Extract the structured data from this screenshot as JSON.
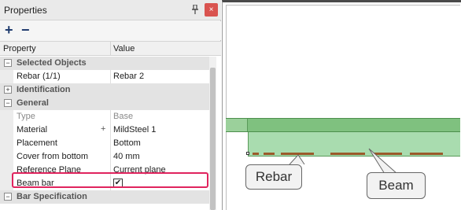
{
  "panel": {
    "title": "Properties",
    "pin_glyph": "📌",
    "close_glyph": "×",
    "toolbar": {
      "expand_glyph": "+",
      "collapse_glyph": "−"
    }
  },
  "grid": {
    "headers": {
      "property": "Property",
      "value": "Value"
    },
    "rows": [
      {
        "label": "Selected Objects",
        "category": true,
        "expander": "−"
      },
      {
        "label": "Rebar (1/1)",
        "value": "Rebar 2"
      },
      {
        "label": "Identification",
        "category": true,
        "expander": "+"
      },
      {
        "label": "General",
        "category": true,
        "expander": "−"
      },
      {
        "label": "Type",
        "value": "Base",
        "muted": true
      },
      {
        "label": "Material",
        "value": "MildSteel 1",
        "plus": "+"
      },
      {
        "label": "Placement",
        "value": "Bottom"
      },
      {
        "label": "Cover from bottom",
        "value": "40 mm"
      },
      {
        "label": "Reference Plane",
        "value": "Current plane"
      },
      {
        "label": "Beam bar",
        "value": "✔",
        "checkbox": true,
        "checked": true
      },
      {
        "label": "Bar Specification",
        "category": true,
        "expander": "−"
      }
    ]
  },
  "viewport": {
    "callouts": {
      "rebar": "Rebar",
      "beam": "Beam"
    }
  }
}
